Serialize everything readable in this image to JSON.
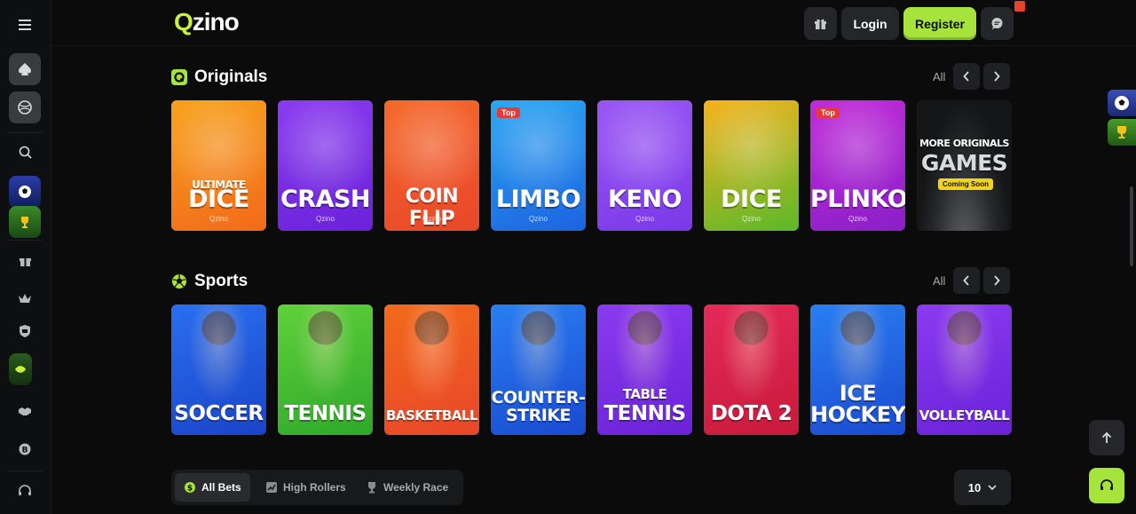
{
  "header": {
    "logo_q": "Q",
    "logo_rest": "zino",
    "login_label": "Login",
    "register_label": "Register",
    "accent_color": "#a6e33b"
  },
  "sidebar": {
    "items": [
      {
        "icon": "menu-icon"
      },
      {
        "icon": "casino-spade-icon"
      },
      {
        "icon": "sports-ball-icon"
      },
      {
        "icon": "search-icon"
      },
      {
        "icon": "soccer-promo-icon"
      },
      {
        "icon": "trophy-promo-icon"
      },
      {
        "icon": "gift-icon"
      },
      {
        "icon": "crown-icon"
      },
      {
        "icon": "shield-icon"
      },
      {
        "icon": "promo-leaf-icon"
      },
      {
        "icon": "handshake-icon"
      },
      {
        "icon": "coin-icon"
      },
      {
        "icon": "headset-icon"
      }
    ]
  },
  "originals": {
    "title": "Originals",
    "all_label": "All",
    "cards": [
      {
        "title": "DICE",
        "pre": "ULTIMATE",
        "sub": "Qzino",
        "badge": "",
        "color1": "#f7a21b",
        "color2": "#f26a1b"
      },
      {
        "title": "CRASH",
        "pre": "",
        "sub": "Qzino",
        "badge": "",
        "color1": "#8a3bf0",
        "color2": "#6a22d8"
      },
      {
        "title": "COIN FLIP",
        "pre": "",
        "sub": "Qzino",
        "badge": "",
        "color1": "#f56a2a",
        "color2": "#e9462a"
      },
      {
        "title": "LIMBO",
        "pre": "",
        "sub": "Qzino",
        "badge": "Top",
        "color1": "#2aa8f2",
        "color2": "#1d63e0"
      },
      {
        "title": "KENO",
        "pre": "",
        "sub": "Qzino",
        "badge": "",
        "color1": "#9b57f5",
        "color2": "#7a38e8"
      },
      {
        "title": "DICE",
        "pre": "",
        "sub": "Qzino",
        "badge": "",
        "color1": "#f7b21b",
        "color2": "#5ab92a"
      },
      {
        "title": "PLINKO",
        "pre": "",
        "sub": "Qzino",
        "badge": "Top",
        "color1": "#c22ad8",
        "color2": "#8a20c8"
      },
      {
        "title": "GAMES",
        "pre": "MORE ORIGINALS",
        "sub": "",
        "badge": "Coming Soon",
        "color1": "#2a2b2e",
        "color2": "#111214"
      }
    ]
  },
  "sports": {
    "title": "Sports",
    "all_label": "All",
    "cards": [
      {
        "title": "SOCCER",
        "pre": "",
        "color1": "#2a6ff0",
        "color2": "#1a44c8"
      },
      {
        "title": "TENNIS",
        "pre": "",
        "color1": "#5fd13a",
        "color2": "#2ea82a"
      },
      {
        "title": "BASKETBALL",
        "pre": "",
        "color1": "#f26a1b",
        "color2": "#e9462a"
      },
      {
        "title": "COUNTER-",
        "pre": "",
        "title2": "STRIKE",
        "color1": "#2a7ff2",
        "color2": "#1a4ad0"
      },
      {
        "title": "TENNIS",
        "pre": "TABLE",
        "color1": "#8a3bf0",
        "color2": "#6a22d8"
      },
      {
        "title": "DOTA 2",
        "pre": "",
        "color1": "#e52a5a",
        "color2": "#c81a3a"
      },
      {
        "title": "ICE",
        "pre": "",
        "title2": "HOCKEY",
        "color1": "#2a7ff2",
        "color2": "#1a4ad0"
      },
      {
        "title": "VOLLEYBALL",
        "pre": "",
        "color1": "#8a3bf0",
        "color2": "#6a22d8"
      }
    ]
  },
  "bets": {
    "tabs": [
      "All Bets",
      "High Rollers",
      "Weekly Race"
    ],
    "active_tab": "All Bets",
    "count_value": "10"
  }
}
